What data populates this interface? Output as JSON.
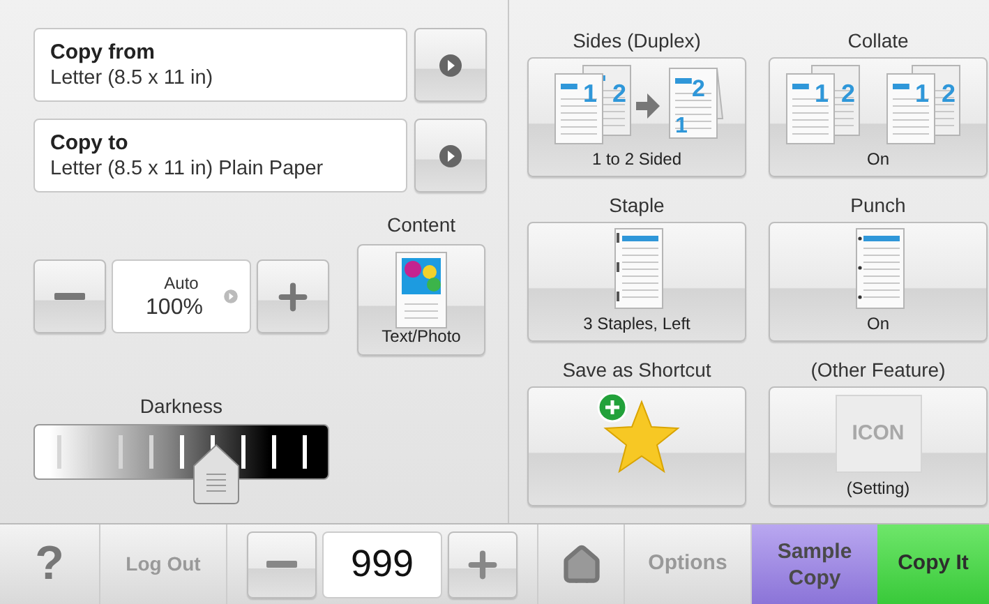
{
  "paper_settings": [
    {
      "label": "Copy from",
      "value": "Letter (8.5 x 11 in)"
    },
    {
      "label": "Copy to",
      "value": "Letter (8.5 x 11 in) Plain Paper"
    }
  ],
  "scale": {
    "mode": "Auto",
    "value": "100%"
  },
  "content": {
    "label": "Content",
    "value": "Text/Photo"
  },
  "darkness": {
    "label": "Darkness",
    "level": 0.62
  },
  "features": [
    {
      "kind": "duplex",
      "title": "Sides (Duplex)",
      "value": "1 to 2 Sided",
      "page_marks": [
        "1",
        "2",
        "2",
        "1"
      ]
    },
    {
      "kind": "collate",
      "title": "Collate",
      "value": "On",
      "page_marks": [
        "1",
        "2",
        "1",
        "2"
      ]
    },
    {
      "kind": "staple",
      "title": "Staple",
      "value": "3 Staples, Left"
    },
    {
      "kind": "punch",
      "title": "Punch",
      "value": "On"
    },
    {
      "kind": "shortcut",
      "title": "Save as Shortcut"
    },
    {
      "kind": "placeholder",
      "title": "(Other Feature)",
      "value": "(Setting)",
      "icon_text": "ICON"
    }
  ],
  "bottom_bar": {
    "help": "?",
    "logout": "Log Out",
    "copies": "999",
    "options": "Options",
    "sample_copy": "Sample Copy",
    "copy_it": "Copy It"
  }
}
